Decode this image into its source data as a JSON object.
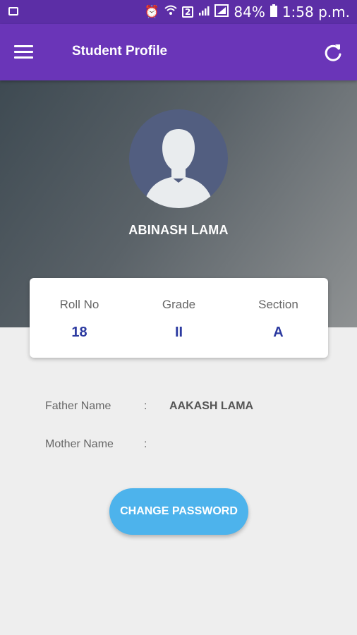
{
  "status_bar": {
    "battery": "84%",
    "time": "1:58 p.m.",
    "sim_badge": "2",
    "icons": [
      "image-icon",
      "alarm-icon",
      "wifi-icon",
      "sim-icon",
      "signal-icon",
      "signal-box-icon",
      "battery-icon"
    ]
  },
  "app_bar": {
    "title": "Student Profile",
    "menu_icon": "menu-icon",
    "refresh_icon": "refresh-icon",
    "accent": "#6a35b8"
  },
  "profile": {
    "name": "ABINASH LAMA",
    "avatar_icon": "user-silhouette-icon"
  },
  "info": {
    "roll_label": "Roll No",
    "roll_value": "18",
    "grade_label": "Grade",
    "grade_value": "II",
    "section_label": "Section",
    "section_value": "A"
  },
  "details": {
    "father_label": "Father Name",
    "father_colon": ":",
    "father_value": "AAKASH LAMA",
    "mother_label": "Mother Name",
    "mother_colon": ":",
    "mother_value": ""
  },
  "actions": {
    "change_password": "CHANGE PASSWORD",
    "button_color": "#4db3ec"
  }
}
